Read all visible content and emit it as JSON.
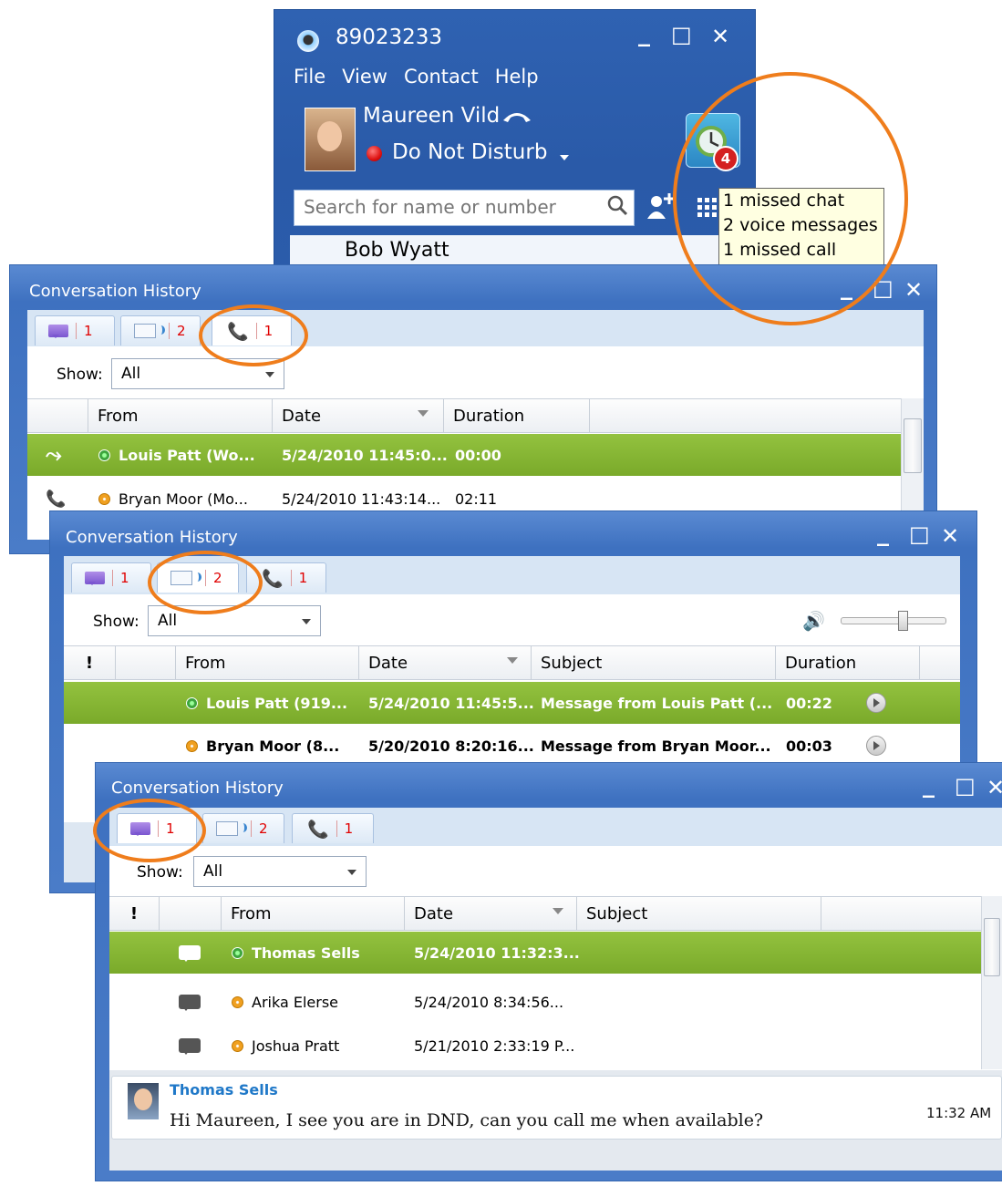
{
  "main_window": {
    "title": "89023233",
    "controls": {
      "minimize": "_",
      "maximize": "□",
      "close": "✕"
    },
    "menu": [
      "File",
      "View",
      "Contact",
      "Help"
    ],
    "user_name": "Maureen Vild",
    "status": "Do Not Disturb",
    "history_badge": "4",
    "search_placeholder": "Search for name or number",
    "tooltip": [
      "1 missed chat",
      "2 voice messages",
      "1 missed call"
    ],
    "contact_partial": "Bob  Wyatt"
  },
  "calls_window": {
    "title": "Conversation History",
    "tabs": [
      {
        "count": "1"
      },
      {
        "count": "2"
      },
      {
        "count": "1"
      }
    ],
    "show_label": "Show:",
    "show_value": "All",
    "columns": [
      "From",
      "Date",
      "Duration"
    ],
    "rows": [
      {
        "from": "Louis Patt  (Wo...",
        "date": "5/24/2010 11:45:0...",
        "duration": "00:00"
      },
      {
        "from": "Bryan Moor  (Mo...",
        "date": "5/24/2010 11:43:14...",
        "duration": "02:11"
      }
    ]
  },
  "voicemail_window": {
    "title": "Conversation History",
    "tabs": [
      {
        "count": "1"
      },
      {
        "count": "2"
      },
      {
        "count": "1"
      }
    ],
    "show_label": "Show:",
    "show_value": "All",
    "columns": [
      "!",
      "From",
      "Date",
      "Subject",
      "Duration"
    ],
    "rows": [
      {
        "from": "Louis Patt  (919...",
        "date": "5/24/2010 11:45:5...",
        "subject": "Message from Louis Patt  (...",
        "duration": "00:22"
      },
      {
        "from": "Bryan Moor   (8...",
        "date": "5/20/2010 8:20:16...",
        "subject": "Message from Bryan Moor...",
        "duration": "00:03"
      }
    ]
  },
  "chat_window": {
    "title": "Conversation History",
    "tabs": [
      {
        "count": "1"
      },
      {
        "count": "2"
      },
      {
        "count": "1"
      }
    ],
    "show_label": "Show:",
    "show_value": "All",
    "columns": [
      "!",
      "From",
      "Date",
      "Subject"
    ],
    "rows": [
      {
        "from": "Thomas Sells",
        "date": "5/24/2010 11:32:3..."
      },
      {
        "from": "Arika Elerse",
        "date": "5/24/2010 8:34:56..."
      },
      {
        "from": "Joshua Pratt",
        "date": "5/21/2010 2:33:19 P..."
      }
    ],
    "preview": {
      "sender": "Thomas Sells",
      "message": "Hi Maureen, I see you are in DND, can you call me when available?",
      "time": "11:32 AM"
    }
  },
  "colors": {
    "accent_ring": "#ef7d1c",
    "selected_row": "#86b535",
    "title_bar": "#3e71c0",
    "badge": "#d42020"
  }
}
